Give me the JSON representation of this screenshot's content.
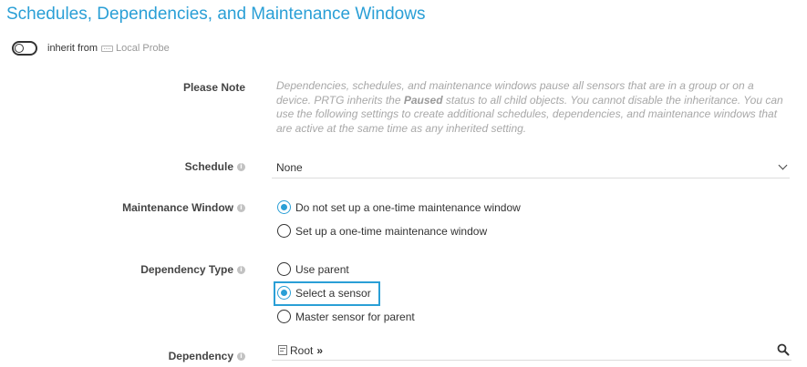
{
  "section": {
    "title": "Schedules, Dependencies, and Maintenance Windows"
  },
  "inherit": {
    "label": "inherit from",
    "source_name": "Local Probe",
    "source_icon": "probe-icon",
    "toggle_state": "off"
  },
  "please_note": {
    "label": "Please Note",
    "text_part1": "Dependencies, schedules, and maintenance windows pause all sensors that are in a group or on a device. PRTG inherits the ",
    "text_bold": "Paused",
    "text_part2": " status to all child objects. You cannot disable the inheritance. You can use the following settings to create additional schedules, dependencies, and maintenance windows that are active at the same time as any inherited setting."
  },
  "schedule": {
    "label": "Schedule",
    "selected": "None"
  },
  "maintenance_window": {
    "label": "Maintenance Window",
    "options": [
      {
        "label": "Do not set up a one-time maintenance window",
        "selected": true
      },
      {
        "label": "Set up a one-time maintenance window",
        "selected": false
      }
    ]
  },
  "dependency_type": {
    "label": "Dependency Type",
    "options": [
      {
        "label": "Use parent",
        "selected": false
      },
      {
        "label": "Select a sensor",
        "selected": true
      },
      {
        "label": "Master sensor for parent",
        "selected": false
      }
    ]
  },
  "dependency": {
    "label": "Dependency",
    "value": "Root",
    "separator": "»"
  },
  "colors": {
    "accent": "#2a9fd6",
    "note_text": "#a8a8a8"
  }
}
